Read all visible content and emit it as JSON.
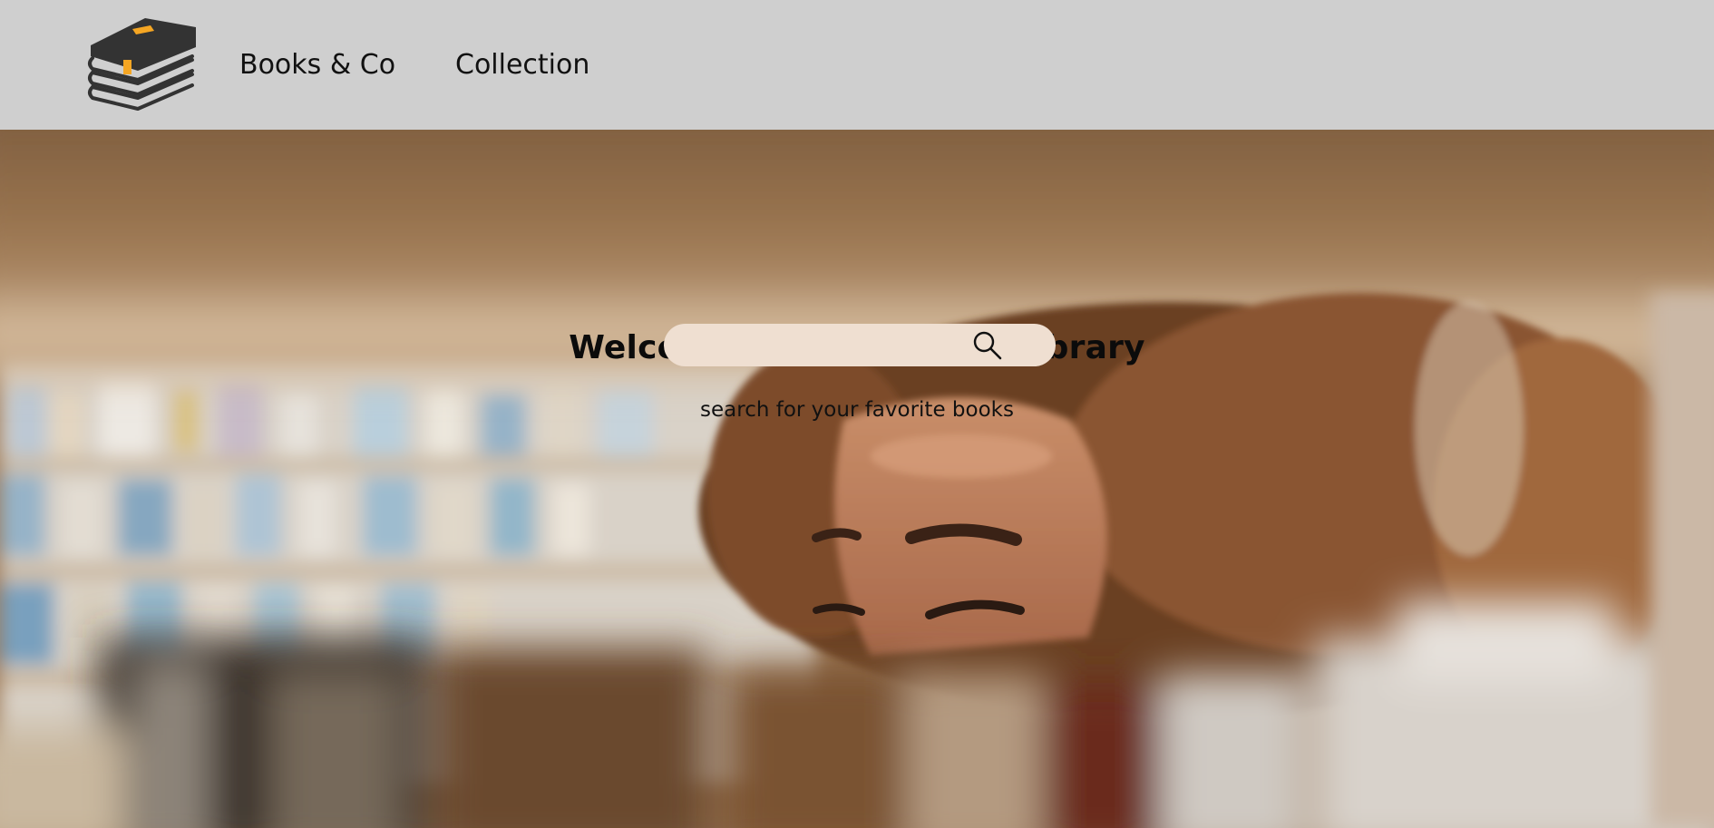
{
  "navbar": {
    "logo_icon": "stacked-books-logo-icon",
    "brand_label": "Books & Co",
    "collection_label": "Collection",
    "background_color": "#cfcfcf"
  },
  "hero": {
    "title": "Welcome To Your Home Library",
    "subtitle": "search for your favorite books",
    "background_image": "person-reading-between-library-shelves-photo"
  },
  "search": {
    "value": "",
    "placeholder": "",
    "icon": "search-icon",
    "field_color": "#efdfd1"
  }
}
